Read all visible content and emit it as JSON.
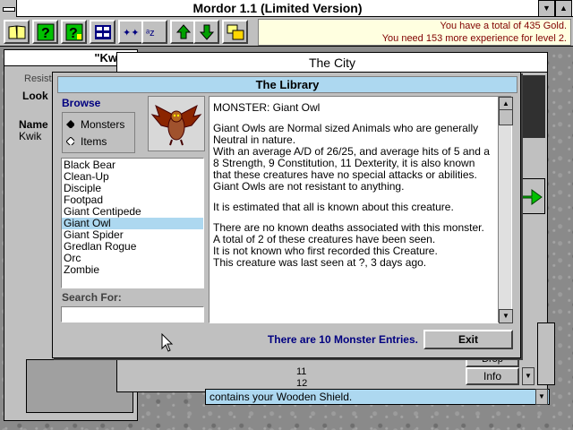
{
  "app": {
    "title": "Mordor 1.1 (Limited Version)",
    "gold_text": "You have a total of 435 Gold.",
    "exp_text": "You need 153 more experience for level 2."
  },
  "toolbar": {
    "icons": [
      "book-icon",
      "help-icon",
      "question-icon",
      "bank-icon",
      "party-icon",
      "spell-icon",
      "upload-icon",
      "download-icon",
      "windows-icon"
    ]
  },
  "background": {
    "char_name": "\"Kw",
    "resist_label": "Resist.",
    "look_label": "Look",
    "name_label": "Name",
    "name_value": "Kwik",
    "city_title": "The City",
    "list_number_1": "11",
    "list_number_2": "12",
    "info_button": "Info",
    "drop_button": "Drop",
    "message": "contains your Wooden Shield."
  },
  "library": {
    "title": "The Library",
    "browse_label": "Browse",
    "radio_monsters": "Monsters",
    "radio_items": "Items",
    "monsters": [
      "Black Bear",
      "Clean-Up",
      "Disciple",
      "Footpad",
      "Giant Centipede",
      "Giant Owl",
      "Giant Spider",
      "Gredlan Rogue",
      "Orc",
      "Zombie"
    ],
    "selected_index": 5,
    "search_label": "Search For:",
    "search_value": "",
    "info": {
      "heading": "MONSTER: Giant Owl",
      "p1": "Giant Owls are Normal sized Animals who are generally Neutral in nature.",
      "p2": "With an average A/D of 26/25, and average hits of 5 and a 8 Strength, 9 Constitution, 11 Dexterity, it is also known that these creatures have no special attacks or abilities.",
      "p3": "Giant Owls are not resistant to anything.",
      "p4": "It is estimated that all is known about this creature.",
      "p5": "There are no known deaths associated with this monster.",
      "p6": "A total of 2 of these creatures have been seen.",
      "p7": "It is not known who first recorded this Creature.",
      "p8": "This creature was last seen at ?, 3 days ago."
    },
    "count_text": "There are 10 Monster Entries.",
    "exit_button": "Exit"
  },
  "colors": {
    "highlight": "#add8f0",
    "count_text": "#000080",
    "gold_text": "#800000"
  }
}
